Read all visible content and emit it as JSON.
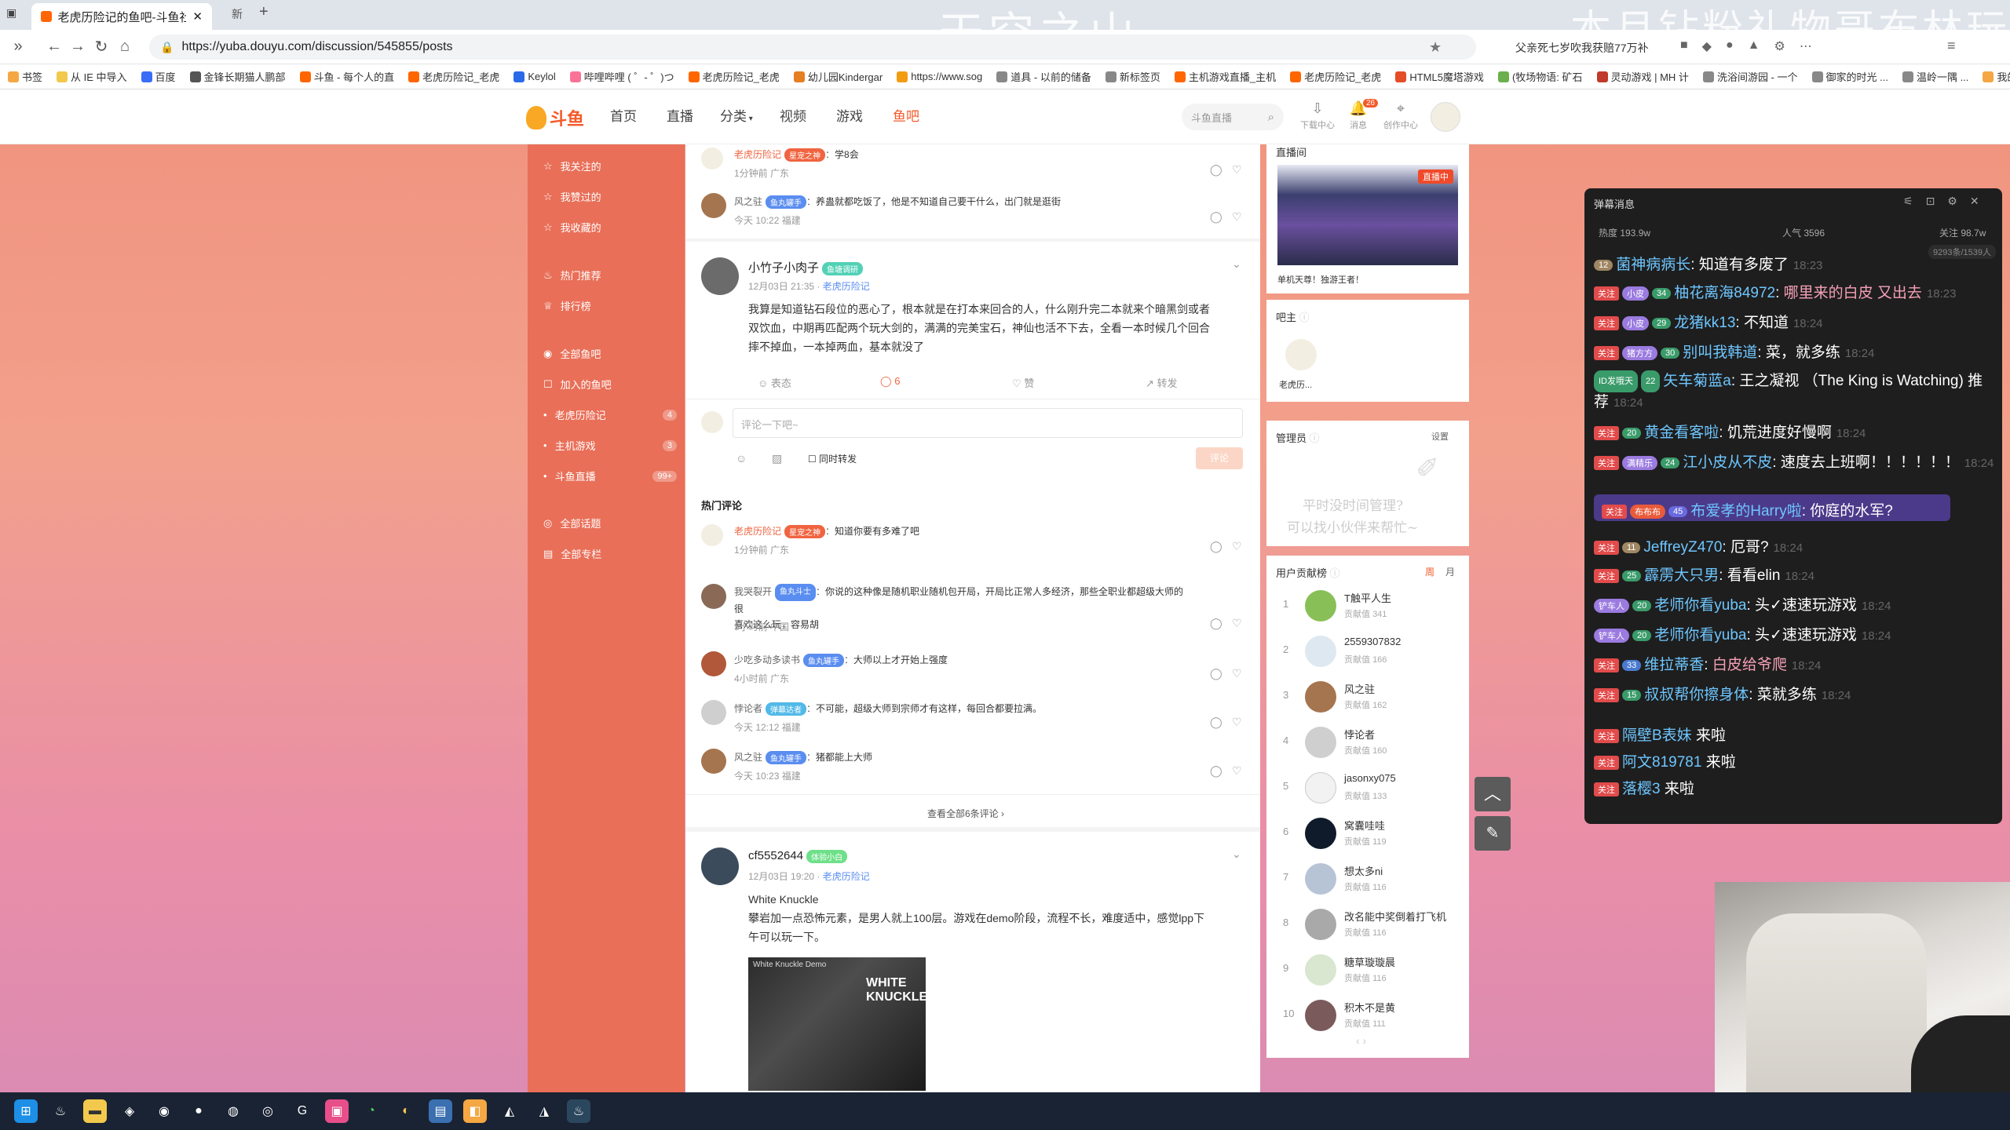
{
  "browser": {
    "tabs": [
      {
        "label": "老虎历险记的鱼吧-斗鱼社区,直播"
      },
      {
        "label": "新"
      }
    ],
    "url": "https://yuba.douyu.com/discussion/545855/posts",
    "bookmarks": [
      "书签",
      "从 IE 中导入",
      "百度",
      "金锋长期猫人鹏部",
      "斗鱼 - 每个人的直",
      "老虎历险记_老虎",
      "Keylol",
      "哔哩哔哩 ( ゜- ゜)つ",
      "老虎历险记_老虎",
      "幼儿园Kindergar",
      "https://www.sog",
      "道具 - 以前的储备",
      "新标签页",
      "主机游戏直播_主机",
      "老虎历险记_老虎",
      "HTML5魔塔游戏",
      "(牧场物语: 矿石",
      "灵动游戏 | MH 计",
      "洗浴间游园 - 一个",
      "御家的时光 ...",
      "温岭一隅 ...",
      "我的京"
    ],
    "overlay_left": "天空之山",
    "overlay_right": "本月钻粉礼物哥布林玩偶",
    "search_engine_hint": "父亲死七岁吹我获赔77万补"
  },
  "site": {
    "logo_text": "斗鱼",
    "nav": [
      "首页",
      "直播",
      "分类",
      "视频",
      "游戏",
      "鱼吧"
    ],
    "search_placeholder": "斗鱼直播",
    "icons": [
      {
        "label": "下载中心",
        "icon": "download-icon"
      },
      {
        "label": "消息",
        "icon": "bell-icon",
        "badge": "26"
      },
      {
        "label": "创作中心",
        "icon": "location-icon"
      }
    ]
  },
  "sidebar": {
    "items": [
      {
        "label": "我关注的"
      },
      {
        "label": "我赞过的"
      },
      {
        "label": "我收藏的"
      },
      {
        "label": "热门推荐"
      },
      {
        "label": "排行榜"
      },
      {
        "label": "全部鱼吧"
      },
      {
        "label": "加入的鱼吧"
      },
      {
        "label": "老虎历险记",
        "count": "4"
      },
      {
        "label": "主机游戏",
        "count": "3"
      },
      {
        "label": "斗鱼直播",
        "count": "99+"
      },
      {
        "label": "全部话题"
      },
      {
        "label": "全部专栏"
      }
    ]
  },
  "feed": {
    "top_comments": [
      {
        "user": "老虎历险记",
        "badge": "星宠之神",
        "text": "学8会",
        "time": "1分钟前",
        "loc": "广东"
      },
      {
        "user": "风之驻",
        "badge": "鱼丸罐手",
        "text": "养蛊就都吃饭了，他是不知道自己要干什么，出门就是逛街",
        "time": "今天 10:22",
        "loc": "福建"
      }
    ],
    "post1": {
      "user": "小竹子小肉子",
      "badge": "鱼塘调研",
      "time": "12月03日 21:35",
      "group": "老虎历险记",
      "text_lines": [
        "我算是知道钻石段位的恶心了，根本就是在打本来回合的人，什么刚升完二本就来个暗黑剑或者",
        "双饮血，中期再匹配两个玩大剑的，满满的完美宝石，神仙也活不下去，全看一本时候几个回合",
        "摔不掉血，一本掉两血，基本就没了"
      ],
      "actions": {
        "react": "表态",
        "comments": "6",
        "like": "赞",
        "share": "转发"
      },
      "comment_placeholder": "评论一下吧~",
      "also_forward": "同时转发",
      "submit": "评论",
      "hot_title": "热门评论",
      "hot_comments": [
        {
          "user": "老虎历险记",
          "badge": "星宠之神",
          "text": "知道你要有多难了吧",
          "time": "1分钟前",
          "loc": "广东"
        },
        {
          "user": "我哭裂开",
          "badge": "鱼丸斗士",
          "text": "你说的这种像是随机职业随机包开局，开局比正常人多经济，那些全职业都超级大师的很",
          "text2": "喜欢这么玩，容易胡",
          "time": "3小时前",
          "loc": "中国"
        },
        {
          "user": "少吃多动多读书",
          "badge": "鱼丸罐手",
          "text": "大师以上才开始上强度",
          "time": "4小时前",
          "loc": "广东"
        },
        {
          "user": "悖论者",
          "badge": "弹幕达者",
          "text": "不可能，超级大师到宗师才有这样，每回合都要拉满。",
          "time": "今天 12:12",
          "loc": "福建"
        },
        {
          "user": "风之驻",
          "badge": "鱼丸罐手",
          "text": "猪都能上大师",
          "time": "今天 10:23",
          "loc": "福建"
        }
      ],
      "view_all": "查看全部6条评论"
    },
    "post2": {
      "user": "cf5552644",
      "badge": "体验小白",
      "time": "12月03日 19:20",
      "group": "老虎历险记",
      "title": "White Knuckle",
      "text_lines": [
        "攀岩加一点恐怖元素，是男人就上100层。游戏在demo阶段，流程不长，难度适中，感觉lpp下",
        "午可以玩一下。"
      ],
      "image_label": "WHITE KNUCKLE",
      "image_caption": "White Knuckle Demo"
    }
  },
  "right": {
    "live_title": "直播间",
    "live_badge": "直播中",
    "live_caption": "单机天尊！独游王者！",
    "owner_title": "吧主",
    "owner_name": "老虎历...",
    "admin_title": "管理员",
    "admin_settings": "设置",
    "admin_empty_line1": "平时没时间管理?",
    "admin_empty_line2": "可以找小伙伴来帮忙~",
    "contrib_title": "用户贡献榜",
    "contrib_tabs": [
      "周",
      "月"
    ],
    "contrib_label": "贡献值",
    "ranking": [
      {
        "rank": "1",
        "name": "T触平人生",
        "value": "341"
      },
      {
        "rank": "2",
        "name": "2559307832",
        "value": "166"
      },
      {
        "rank": "3",
        "name": "风之驻",
        "value": "162"
      },
      {
        "rank": "4",
        "name": "悖论者",
        "value": "160"
      },
      {
        "rank": "5",
        "name": "jasonxy075",
        "value": "133"
      },
      {
        "rank": "6",
        "name": "窝囊哇哇",
        "value": "119"
      },
      {
        "rank": "7",
        "name": "想太多ni",
        "value": "116"
      },
      {
        "rank": "8",
        "name": "改名能中奖倒着打飞机",
        "value": "116"
      },
      {
        "rank": "9",
        "name": "糖草璇璇晨",
        "value": "116"
      },
      {
        "rank": "10",
        "name": "积木不是黄",
        "value": "111"
      }
    ]
  },
  "danmu": {
    "title": "弹幕消息",
    "hot": "热度 193.9w",
    "popularity": "人气 3596",
    "follow": "关注 98.7w",
    "count": "9293条/1539人",
    "messages": [
      {
        "lv": "12",
        "user": "菌神病病长",
        "text": "知道有多废了",
        "time": "18:23"
      },
      {
        "lv": "34",
        "fan": "小皮",
        "user": "柚花离海84972",
        "text": "哪里来的白皮 又出去",
        "time": "18:23"
      },
      {
        "lv": "29",
        "fan": "小皮",
        "user": "龙猪kk13",
        "text": "不知道",
        "time": "18:24"
      },
      {
        "lv": "30",
        "fan": "猪方方",
        "user": "别叫我韩道",
        "text": "菜，就多练",
        "time": "18:24"
      },
      {
        "lv": "22",
        "fan": "ID发哦天",
        "user": "矢车菊蓝a",
        "text": "王之凝视 （The King is Watching) 推荐",
        "time": "18:24"
      },
      {
        "lv": "20",
        "user": "黄金看客啦",
        "text": "饥荒进度好慢啊",
        "time": "18:24"
      },
      {
        "lv": "24",
        "fan": "满精乐",
        "user": "江小皮从不皮",
        "text": "速度去上班啊！！！！！！",
        "time": "18:24"
      },
      {
        "lv": "45",
        "fan": "布布布",
        "user": "布爱孝的Harry啦",
        "text": "你庭的水军?",
        "time": ""
      },
      {
        "lv": "11",
        "user": "JeffreyZ470",
        "text": "厄哥?",
        "time": "18:24"
      },
      {
        "lv": "25",
        "user": "霹雳大只男",
        "text": "看看elin",
        "time": "18:24"
      },
      {
        "lv": "20",
        "fan": "铲车人",
        "user": "老师你看yuba",
        "text": "头✓速速玩游戏",
        "time": "18:24"
      },
      {
        "lv": "20",
        "fan": "铲车人",
        "user": "老师你看yuba",
        "text": "头✓速速玩游戏",
        "time": "18:24"
      },
      {
        "lv": "33",
        "user": "维拉蒂香",
        "text": "白皮给爷爬",
        "time": "18:24"
      },
      {
        "lv": "15",
        "user": "叔叔帮你擦身体",
        "text": "菜就多练",
        "time": "18:24"
      },
      {
        "user": "隔壁B表妹",
        "text": "来啦"
      },
      {
        "user": "阿文819781",
        "text": "来啦"
      },
      {
        "user": "落樱3",
        "text": "来啦"
      }
    ]
  }
}
